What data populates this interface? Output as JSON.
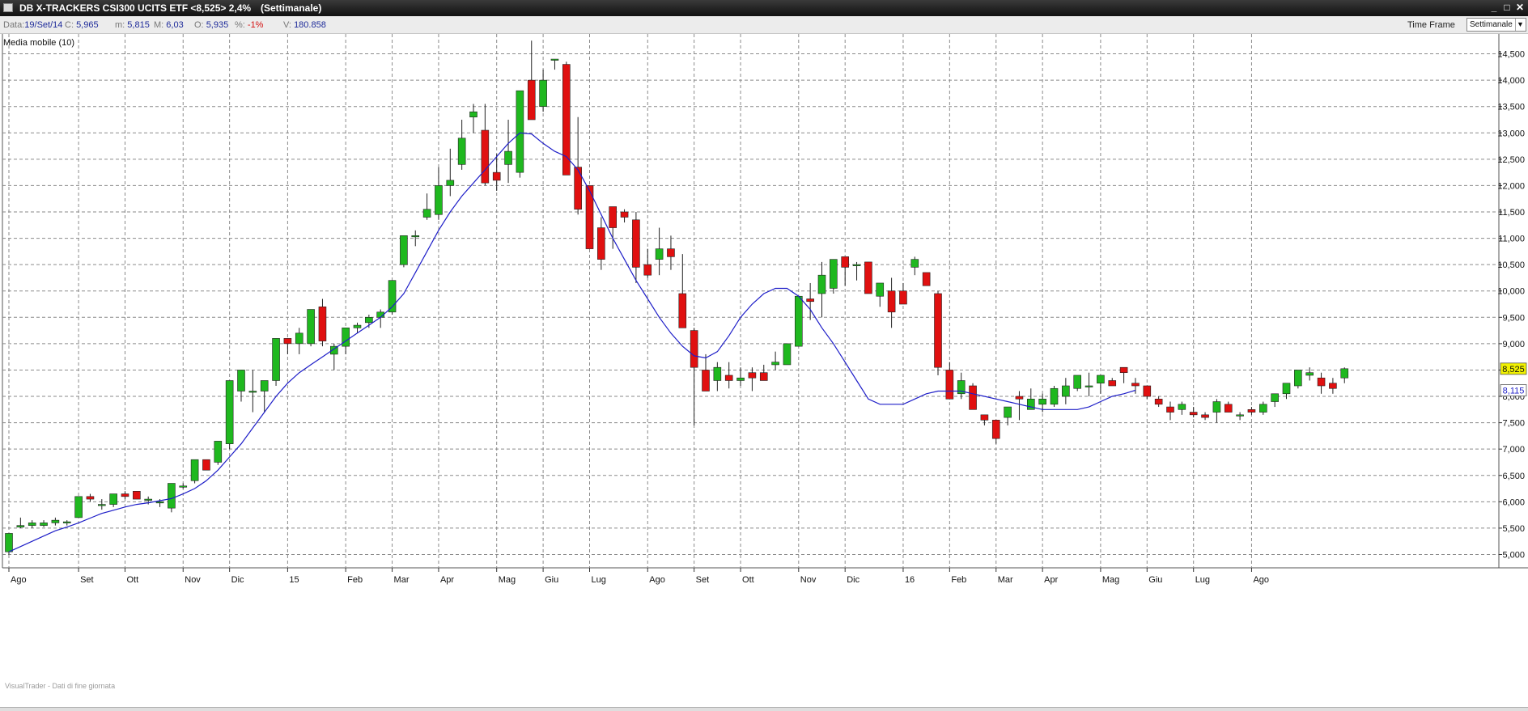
{
  "window": {
    "title": "DB X-TRACKERS CSI300 UCITS ETF <8,525> 2,4%",
    "subtitle": "(Settimanale)"
  },
  "info": {
    "data_label": "Data:",
    "data_value": "19/Set/14",
    "c_label": "C:",
    "c_value": "5,965",
    "m_label": "m:",
    "m_value": "5,815",
    "M_label": "M:",
    "M_value": "6,03",
    "o_label": "O:",
    "o_value": "5,935",
    "pct_label": "%:",
    "pct_value": "-1%",
    "v_label": "V:",
    "v_value": "180.858"
  },
  "timeframe": {
    "label": "Time Frame",
    "selected": "Settimanale"
  },
  "indicator_label": "Media mobile (10)",
  "watermark": "VisualTrader - Dati di fine giornata",
  "colors": {
    "up": "#1fb81f",
    "down": "#e01010",
    "ma": "#1e1ec8",
    "grid": "#8a8a8a",
    "last_price_bg": "#f2f200"
  },
  "chart_data": {
    "type": "candlestick",
    "ylim": [
      4900,
      14800
    ],
    "y_ticks": [
      5000,
      5500,
      6000,
      6500,
      7000,
      7500,
      8000,
      8500,
      9000,
      9500,
      10000,
      10500,
      11000,
      11500,
      12000,
      12500,
      13000,
      13500,
      14000,
      14500
    ],
    "y_tick_labels": [
      "5,000",
      "5,500",
      "6,000",
      "6,500",
      "7,000",
      "7,500",
      "8,000",
      "8,500",
      "9,000",
      "9,500",
      "10,000",
      "10,500",
      "11,000",
      "11,500",
      "12,000",
      "12,500",
      "13,000",
      "13,500",
      "14,000",
      "14,500"
    ],
    "x_ticks": [
      {
        "label": "Ago",
        "index": 0
      },
      {
        "label": "Set",
        "index": 6
      },
      {
        "label": "Ott",
        "index": 10
      },
      {
        "label": "Nov",
        "index": 15
      },
      {
        "label": "Dic",
        "index": 19
      },
      {
        "label": "15",
        "index": 24
      },
      {
        "label": "Feb",
        "index": 29
      },
      {
        "label": "Mar",
        "index": 33
      },
      {
        "label": "Apr",
        "index": 37
      },
      {
        "label": "Mag",
        "index": 42
      },
      {
        "label": "Giu",
        "index": 46
      },
      {
        "label": "Lug",
        "index": 50
      },
      {
        "label": "Ago",
        "index": 55
      },
      {
        "label": "Set",
        "index": 59
      },
      {
        "label": "Ott",
        "index": 63
      },
      {
        "label": "Nov",
        "index": 68
      },
      {
        "label": "Dic",
        "index": 72
      },
      {
        "label": "16",
        "index": 77
      },
      {
        "label": "Feb",
        "index": 81
      },
      {
        "label": "Mar",
        "index": 85
      },
      {
        "label": "Apr",
        "index": 89
      },
      {
        "label": "Mag",
        "index": 94
      },
      {
        "label": "Giu",
        "index": 98
      },
      {
        "label": "Lug",
        "index": 102
      },
      {
        "label": "Ago",
        "index": 107
      }
    ],
    "last_price": 8525,
    "last_price_label": "8,525",
    "ma_last": 8115,
    "ma_last_label": "8,115",
    "candles": [
      [
        5050,
        5400,
        5000,
        5400
      ],
      [
        5520,
        5700,
        5500,
        5550
      ],
      [
        5550,
        5650,
        5500,
        5600
      ],
      [
        5550,
        5650,
        5520,
        5600
      ],
      [
        5600,
        5700,
        5550,
        5650
      ],
      [
        5600,
        5650,
        5550,
        5620
      ],
      [
        5700,
        6100,
        5700,
        6100
      ],
      [
        6100,
        6150,
        6000,
        6050
      ],
      [
        5950,
        6050,
        5850,
        5950
      ],
      [
        5950,
        6150,
        5900,
        6150
      ],
      [
        6150,
        6200,
        6050,
        6100
      ],
      [
        6200,
        6200,
        6050,
        6050
      ],
      [
        6050,
        6100,
        5950,
        6050
      ],
      [
        6000,
        6050,
        5900,
        6000
      ],
      [
        5880,
        6350,
        5800,
        6350
      ],
      [
        6300,
        6350,
        6250,
        6300
      ],
      [
        6400,
        6800,
        6350,
        6800
      ],
      [
        6800,
        6800,
        6600,
        6600
      ],
      [
        6750,
        7150,
        6700,
        7150
      ],
      [
        7100,
        8300,
        7000,
        8300
      ],
      [
        8100,
        8500,
        7900,
        8500
      ],
      [
        8100,
        8500,
        7700,
        8100
      ],
      [
        8100,
        8300,
        7700,
        8300
      ],
      [
        8300,
        9100,
        8200,
        9100
      ],
      [
        9100,
        9100,
        8800,
        9000
      ],
      [
        9000,
        9300,
        8800,
        9200
      ],
      [
        9000,
        9650,
        8950,
        9650
      ],
      [
        9700,
        9850,
        8950,
        9050
      ],
      [
        8800,
        9000,
        8500,
        8950
      ],
      [
        8950,
        9300,
        8800,
        9300
      ],
      [
        9300,
        9400,
        9200,
        9350
      ],
      [
        9400,
        9550,
        9300,
        9500
      ],
      [
        9500,
        9650,
        9300,
        9600
      ],
      [
        9600,
        10200,
        9550,
        10200
      ],
      [
        10500,
        11050,
        10450,
        11050
      ],
      [
        11050,
        11150,
        10850,
        11050
      ],
      [
        11400,
        11850,
        11350,
        11550
      ],
      [
        11450,
        12350,
        11350,
        12000
      ],
      [
        12000,
        12700,
        11800,
        12100
      ],
      [
        12400,
        13250,
        12300,
        12900
      ],
      [
        13300,
        13550,
        13000,
        13400
      ],
      [
        13050,
        13550,
        12000,
        12050
      ],
      [
        12250,
        12600,
        11900,
        12100
      ],
      [
        12400,
        13250,
        12050,
        12650
      ],
      [
        12250,
        13800,
        12150,
        13800
      ],
      [
        14000,
        14750,
        13900,
        13250
      ],
      [
        13500,
        14200,
        13400,
        14000
      ],
      [
        14400,
        14400,
        14200,
        14400
      ],
      [
        14300,
        14350,
        12400,
        12200
      ],
      [
        12350,
        13300,
        11450,
        11550
      ],
      [
        12000,
        12000,
        11300,
        10800
      ],
      [
        11200,
        11400,
        10400,
        10600
      ],
      [
        11600,
        11550,
        10800,
        11200
      ],
      [
        11500,
        11550,
        11300,
        11400
      ],
      [
        11350,
        11500,
        10150,
        10450
      ],
      [
        10500,
        10800,
        10250,
        10300
      ],
      [
        10600,
        11200,
        10300,
        10800
      ],
      [
        10800,
        11050,
        10400,
        10650
      ],
      [
        9950,
        10700,
        9800,
        9300
      ],
      [
        9250,
        9300,
        7450,
        8550
      ],
      [
        8500,
        8800,
        8250,
        8100
      ],
      [
        8300,
        8650,
        8100,
        8550
      ],
      [
        8400,
        8650,
        8150,
        8300
      ],
      [
        8300,
        8550,
        8200,
        8350
      ],
      [
        8450,
        8550,
        8100,
        8350
      ],
      [
        8450,
        8600,
        8400,
        8300
      ],
      [
        8600,
        8850,
        8500,
        8650
      ],
      [
        8600,
        8850,
        8650,
        9000
      ],
      [
        8950,
        9450,
        8950,
        9900
      ],
      [
        9850,
        10150,
        9450,
        9800
      ],
      [
        9950,
        10550,
        9500,
        10300
      ],
      [
        10050,
        10600,
        9950,
        10600
      ],
      [
        10650,
        10650,
        10100,
        10450
      ],
      [
        10500,
        10550,
        10200,
        10500
      ],
      [
        10550,
        10550,
        10150,
        9950
      ],
      [
        9900,
        9950,
        9700,
        10150
      ],
      [
        10000,
        10250,
        9300,
        9600
      ],
      [
        10000,
        10150,
        9800,
        9750
      ],
      [
        10450,
        10650,
        10300,
        10600
      ],
      [
        10350,
        10350,
        10100,
        10100
      ],
      [
        9950,
        10000,
        8400,
        8550
      ],
      [
        8500,
        8650,
        8000,
        7950
      ],
      [
        8050,
        8450,
        7950,
        8300
      ],
      [
        8200,
        8250,
        7850,
        7750
      ],
      [
        7650,
        7650,
        7450,
        7550
      ],
      [
        7550,
        7550,
        7100,
        7200
      ],
      [
        7600,
        7700,
        7450,
        7800
      ],
      [
        8000,
        8100,
        7550,
        7950
      ],
      [
        7750,
        8150,
        7750,
        7950
      ],
      [
        7850,
        8050,
        7700,
        7950
      ],
      [
        7850,
        8200,
        7800,
        8150
      ],
      [
        8000,
        8350,
        7850,
        8200
      ],
      [
        8150,
        8400,
        8100,
        8400
      ],
      [
        8200,
        8450,
        8000,
        8200
      ],
      [
        8250,
        8350,
        8050,
        8400
      ],
      [
        8300,
        8350,
        8200,
        8200
      ],
      [
        8550,
        8550,
        8250,
        8450
      ],
      [
        8250,
        8350,
        8050,
        8200
      ],
      [
        8200,
        8200,
        7950,
        8000
      ],
      [
        7950,
        8000,
        7800,
        7850
      ],
      [
        7800,
        7900,
        7550,
        7700
      ],
      [
        7750,
        7900,
        7650,
        7850
      ],
      [
        7700,
        7800,
        7600,
        7650
      ],
      [
        7650,
        7700,
        7550,
        7600
      ],
      [
        7700,
        7950,
        7500,
        7900
      ],
      [
        7850,
        7900,
        7700,
        7700
      ],
      [
        7650,
        7700,
        7550,
        7650
      ],
      [
        7750,
        7800,
        7650,
        7700
      ],
      [
        7700,
        7900,
        7650,
        7850
      ],
      [
        7900,
        8050,
        7800,
        8050
      ],
      [
        8050,
        8250,
        7950,
        8250
      ],
      [
        8200,
        8500,
        8150,
        8500
      ],
      [
        8400,
        8550,
        8300,
        8450
      ],
      [
        8350,
        8450,
        8050,
        8200
      ],
      [
        8250,
        8350,
        8050,
        8150
      ],
      [
        8350,
        8550,
        8250,
        8525
      ]
    ],
    "ma10": [
      5050,
      5150,
      5250,
      5350,
      5450,
      5520,
      5600,
      5690,
      5780,
      5840,
      5900,
      5950,
      5980,
      6020,
      6060,
      6150,
      6250,
      6400,
      6600,
      6850,
      7100,
      7400,
      7700,
      8000,
      8250,
      8450,
      8600,
      8750,
      8900,
      9050,
      9200,
      9350,
      9500,
      9700,
      9950,
      10350,
      10750,
      11150,
      11500,
      11800,
      12050,
      12300,
      12550,
      12800,
      13000,
      12980,
      12800,
      12650,
      12550,
      12300,
      11900,
      11450,
      11000,
      10600,
      10200,
      9850,
      9500,
      9200,
      8950,
      8770,
      8730,
      8850,
      9150,
      9500,
      9750,
      9950,
      10050,
      10050,
      9900,
      9650,
      9300,
      9000,
      8650,
      8300,
      7950,
      7850,
      7850,
      7850,
      7950,
      8050,
      8100,
      8100,
      8100,
      8050,
      8000,
      7950,
      7900,
      7850,
      7800,
      7750,
      7750,
      7750,
      7750,
      7800,
      7900,
      8000,
      8050,
      8115
    ],
    "ma_start_index": 0
  }
}
